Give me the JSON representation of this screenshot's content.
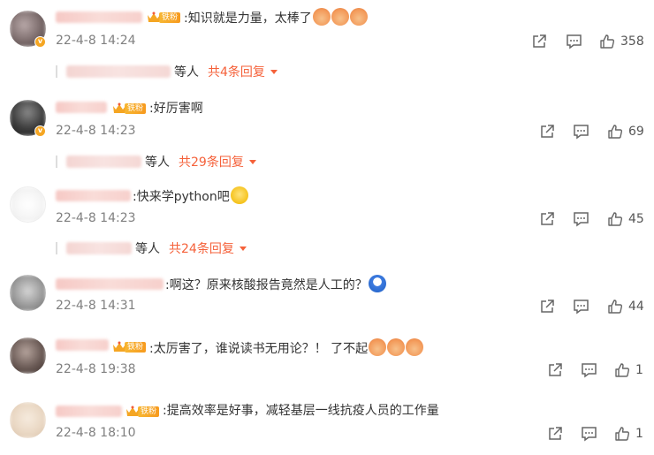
{
  "fan_badge_label": "铁粉",
  "others_label": "等人",
  "comments": [
    {
      "text": ":知识就是力量，太棒了",
      "emojis": [
        "clap-icon",
        "clap-icon",
        "clap-icon"
      ],
      "time": "22-4-8 14:24",
      "likes": "358",
      "reply_label": "共4条回复",
      "avatar_color": "#7a6a6a",
      "verified": true
    },
    {
      "text": ":好厉害啊",
      "emojis": [],
      "time": "22-4-8 14:23",
      "likes": "69",
      "reply_label": "共29条回复",
      "avatar_color": "#3c3c3c",
      "verified": true
    },
    {
      "text": ":快来学python吧",
      "emojis": [
        "laugh-icon"
      ],
      "time": "22-4-8 14:23",
      "likes": "45",
      "reply_label": "共24条回复",
      "avatar_color": "#eeeeee",
      "verified": false
    },
    {
      "text": ":啊这？原来核酸报告竟然是人工的？",
      "emojis": [
        "doraemon-icon"
      ],
      "time": "22-4-8 14:31",
      "likes": "44",
      "reply_label": "",
      "avatar_color": "#9a9a9a",
      "verified": false
    },
    {
      "text": ":太厉害了，谁说读书无用论？！ 了不起",
      "emojis": [
        "clap-icon",
        "clap-icon",
        "clap-icon"
      ],
      "time": "22-4-8 19:38",
      "likes": "1",
      "reply_label": "",
      "avatar_color": "#6a5a55",
      "verified": false
    },
    {
      "text": ":提高效率是好事，减轻基层一线抗疫人员的工作量",
      "emojis": [],
      "time": "22-4-8 18:10",
      "likes": "1",
      "reply_label": "",
      "avatar_color": "#ead8c4",
      "verified": false
    }
  ]
}
